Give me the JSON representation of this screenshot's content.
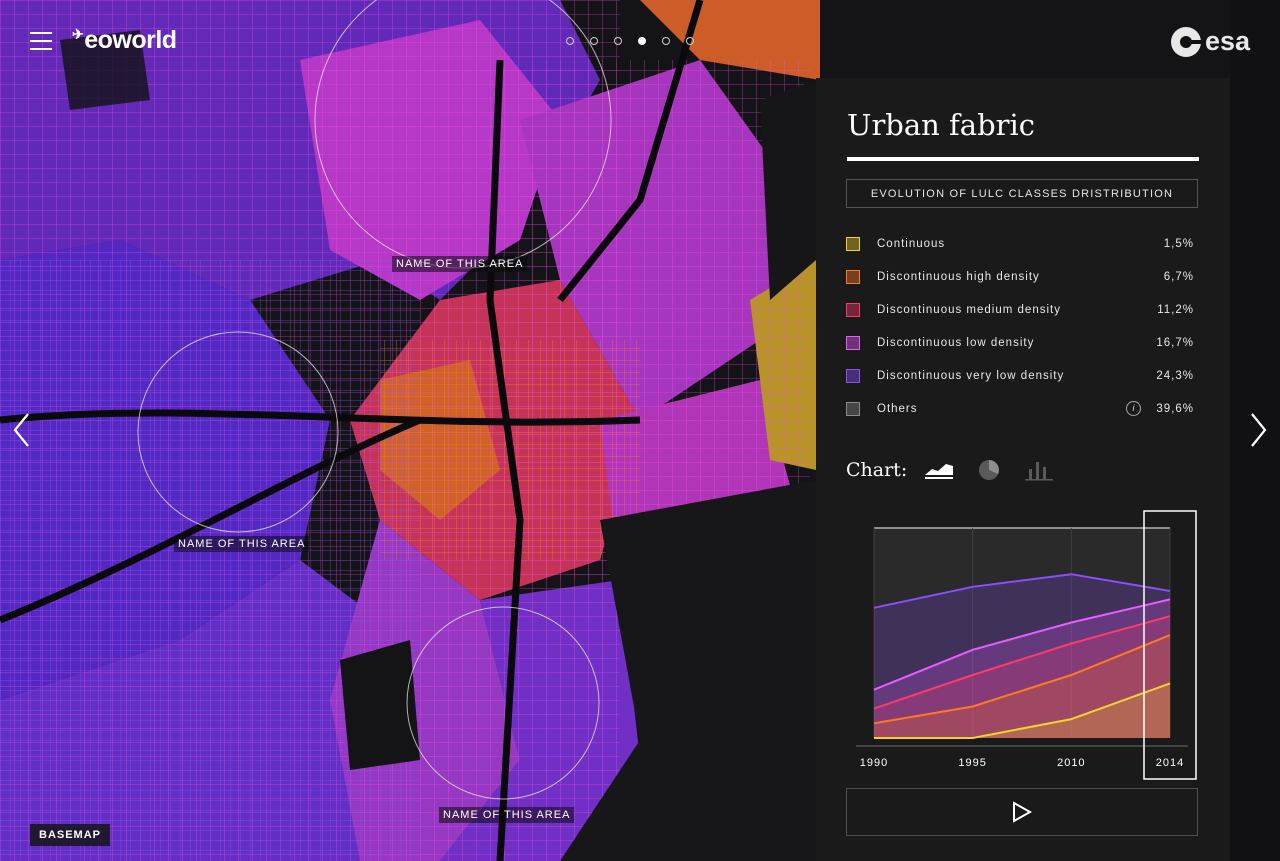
{
  "app": {
    "logo_text": "eoworld",
    "partner_logo_text": "esa"
  },
  "pager": {
    "dots": 6,
    "active_index": 3
  },
  "map": {
    "area_labels": [
      "NAME OF THIS AREA",
      "NAME OF THIS AREA",
      "NAME OF THIS AREA"
    ],
    "basemap_label": "BASEMAP"
  },
  "panel": {
    "title": "Urban fabric",
    "section_title": "EVOLUTION OF LULC CLASSES DRISTRIBUTION",
    "legend": [
      {
        "label": "Continuous",
        "value": "1,5%",
        "color": "#f2d22b",
        "info": false
      },
      {
        "label": "Discontinuous high density",
        "value": "6,7%",
        "color": "#ff7a1f",
        "info": false
      },
      {
        "label": "Discontinuous medium density",
        "value": "11,2%",
        "color": "#ff3a6b",
        "info": false
      },
      {
        "label": "Discontinuous low density",
        "value": "16,7%",
        "color": "#e85cff",
        "info": false
      },
      {
        "label": "Discontinuous very low density",
        "value": "24,3%",
        "color": "#8b4dff",
        "info": false
      },
      {
        "label": "Others",
        "value": "39,6%",
        "color": "#8a8a8a",
        "info": true,
        "info_glyph": "i"
      }
    ],
    "chart_switch": {
      "label": "Chart:",
      "options": [
        {
          "name": "area-chart-icon",
          "active": true
        },
        {
          "name": "pie-chart-icon",
          "active": false
        },
        {
          "name": "bar-chart-icon",
          "active": false
        }
      ]
    },
    "play_icon": "play-icon"
  },
  "chart_data": {
    "type": "area",
    "x": [
      "1990",
      "1995",
      "2010",
      "2014"
    ],
    "selected_x": "2014",
    "ylim": [
      0,
      100
    ],
    "series": [
      {
        "name": "Discontinuous very low density",
        "color": "#8b4dff",
        "values": [
          62,
          72,
          78,
          70
        ]
      },
      {
        "name": "Discontinuous low density",
        "color": "#e85cff",
        "values": [
          23,
          42,
          55,
          66
        ]
      },
      {
        "name": "Discontinuous medium density",
        "color": "#ff3a6b",
        "values": [
          14,
          30,
          45,
          58
        ]
      },
      {
        "name": "Discontinuous high density",
        "color": "#ff7a1f",
        "values": [
          7,
          15,
          30,
          49
        ]
      },
      {
        "name": "Continuous",
        "color": "#f2d22b",
        "values": [
          0,
          0,
          9,
          26
        ]
      }
    ]
  }
}
